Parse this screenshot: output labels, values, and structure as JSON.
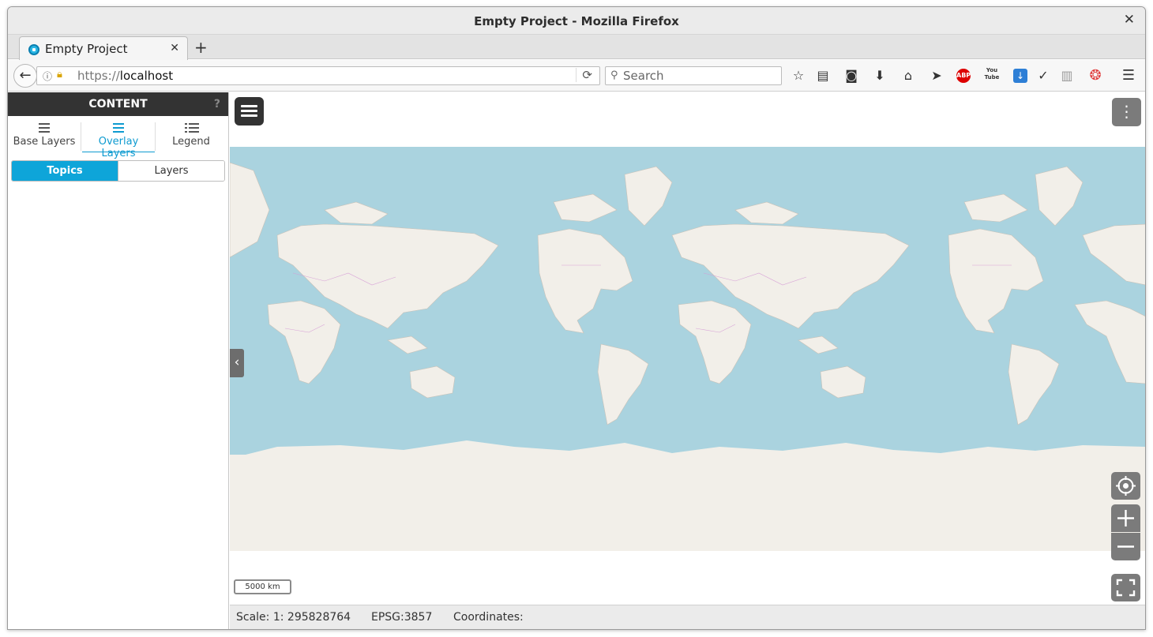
{
  "window": {
    "title": "Empty Project - Mozilla Firefox",
    "close_glyph": "✕"
  },
  "tab": {
    "label": "Empty Project",
    "close_glyph": "✕",
    "new_tab_glyph": "+"
  },
  "nav": {
    "url_scheme": "https://",
    "url_host": "localhost",
    "search_placeholder": "Search",
    "toolbar_icons": [
      "bookmark-star-icon",
      "reading-list-icon",
      "pocket-icon",
      "downloads-icon",
      "home-icon",
      "send-icon",
      "adblock-plus-icon",
      "youtube-icon",
      "download-manager-icon",
      "pocket-dropdown-icon",
      "reader-icon",
      "lifesaver-icon",
      "menu-icon"
    ],
    "adblock_label": "ABP",
    "youtube_label": "You Tube"
  },
  "sidebar": {
    "header": "CONTENT",
    "help_glyph": "?",
    "tabs": [
      {
        "label": "Base Layers",
        "active": false
      },
      {
        "label": "Overlay Layers",
        "active": true
      },
      {
        "label": "Legend",
        "active": false
      }
    ],
    "segments": [
      {
        "label": "Topics",
        "active": true
      },
      {
        "label": "Layers",
        "active": false
      }
    ]
  },
  "map": {
    "scale_bar": "5000 km",
    "colors": {
      "ocean": "#aad3df",
      "land": "#f2efe9",
      "borders": "#d59ad5"
    }
  },
  "status": {
    "scale_label": "Scale: 1: 295828764",
    "epsg": "EPSG:3857",
    "coordinates_label": "Coordinates:"
  }
}
